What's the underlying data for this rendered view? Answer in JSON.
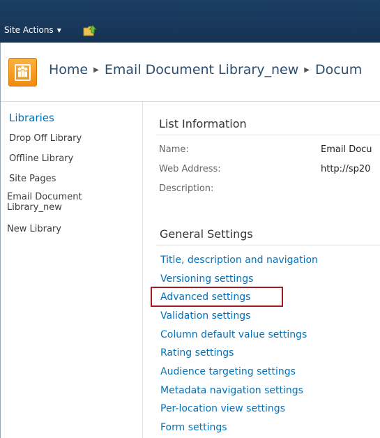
{
  "ribbon": {
    "site_actions_label": "Site Actions",
    "navigate_up_icon": "folder-up-arrow-icon"
  },
  "header": {
    "logo_icon": "people-site-icon",
    "breadcrumb": [
      "Home",
      "Email Document Library_new",
      "Docum"
    ]
  },
  "left_nav": {
    "heading": "Libraries",
    "items": [
      "Drop Off Library",
      "Offline Library",
      "Site Pages",
      "Email Document Library_new",
      "New Library"
    ]
  },
  "list_information": {
    "title": "List Information",
    "rows": [
      {
        "label": "Name:",
        "value": "Email Docu"
      },
      {
        "label": "Web Address:",
        "value": "http://sp20"
      },
      {
        "label": "Description:",
        "value": ""
      }
    ]
  },
  "general_settings": {
    "title": "General Settings",
    "links": [
      "Title, description and navigation",
      "Versioning settings",
      "Advanced settings",
      "Validation settings",
      "Column default value settings",
      "Rating settings",
      "Audience targeting settings",
      "Metadata navigation settings",
      "Per-location view settings",
      "Form settings"
    ],
    "highlighted": "Advanced settings"
  },
  "colors": {
    "ribbon": "#19385c",
    "link": "#0072bc",
    "highlight": "#a31b1f",
    "logo": "#f39a1e"
  }
}
